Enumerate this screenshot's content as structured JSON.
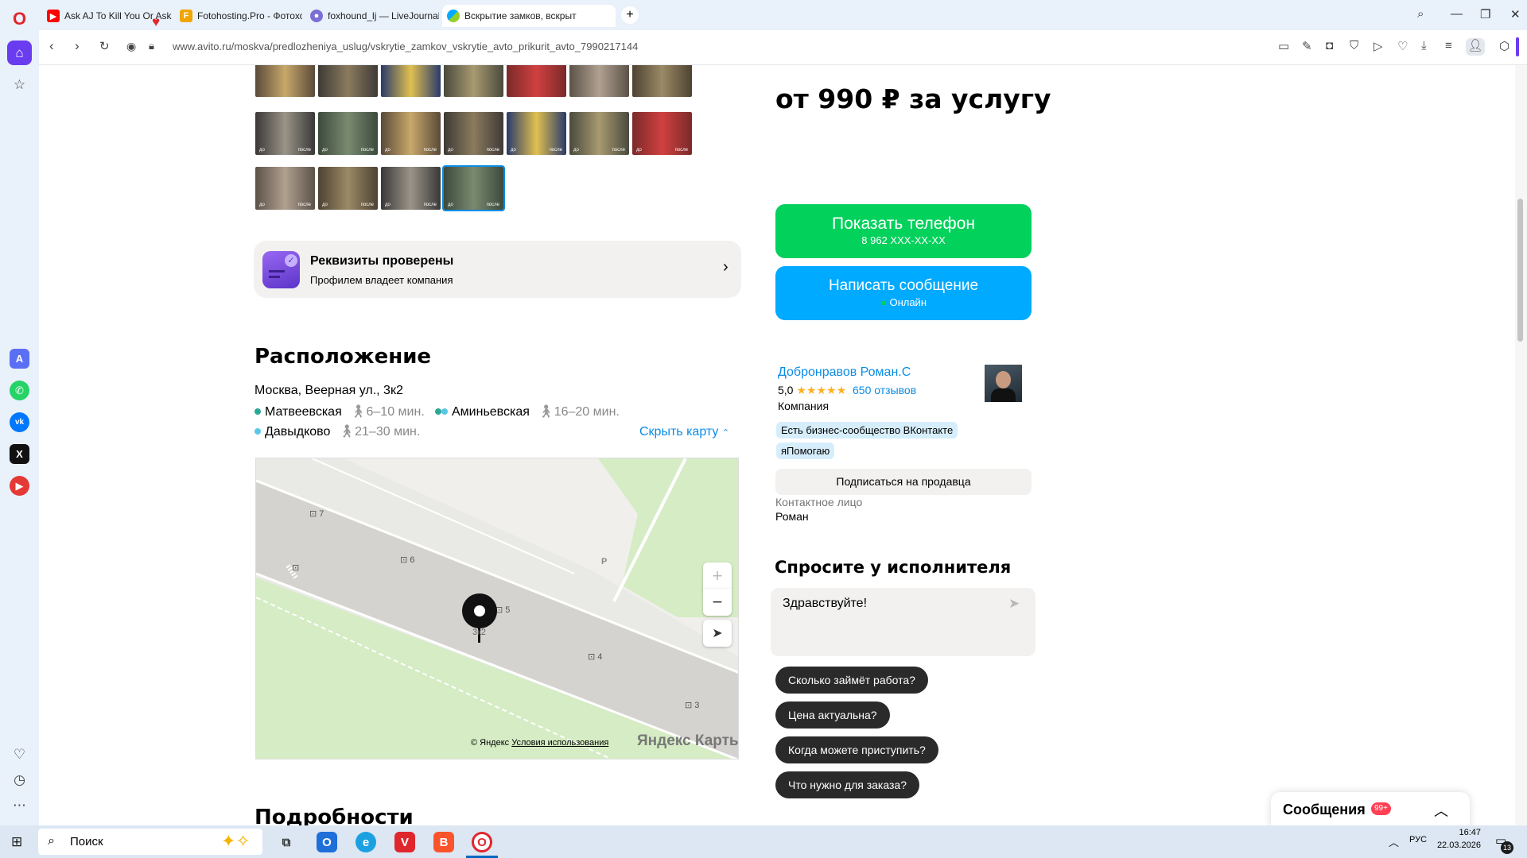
{
  "browser": {
    "tabs": [
      {
        "title": "Ask AJ To Kill You Or Ask",
        "icon": "youtube-icon"
      },
      {
        "title": "Fotohosting.Pro - Фотохо",
        "icon": "fotohosting-icon"
      },
      {
        "title": "foxhound_lj — LiveJournal",
        "icon": "livejournal-icon"
      },
      {
        "title": "Вскрытие замков, вскрыт",
        "icon": "avito-icon"
      }
    ],
    "new_tab": "+",
    "url": "www.avito.ru/moskva/predlozheniya_uslug/vskrytie_zamkov_vskrytie_avto_prikurit_avto_7990217144"
  },
  "listing": {
    "price": "от 990 ₽ за услугу",
    "photo_labels": {
      "before": "до",
      "after": "после"
    },
    "verified": {
      "title": "Реквизиты проверены",
      "subtitle": "Профилем владеет компания"
    },
    "location": {
      "heading": "Расположение",
      "address": "Москва, Веерная ул., 3к2",
      "metro": [
        {
          "name": "Матвеевская",
          "time": "6–10 мин.",
          "color": "#2aa897"
        },
        {
          "name": "Аминьевская",
          "time": "16–20 мин.",
          "color": "#2aa897"
        },
        {
          "name": "Давыдково",
          "time": "21–30 мин.",
          "color": "#5ac8e5"
        }
      ],
      "hide_map": "Скрыть карту"
    },
    "map": {
      "houses": [
        "7",
        "6",
        "5",
        "4",
        "3"
      ],
      "pin_label": "3к2",
      "parking": "P",
      "copyright": "© Яндекс",
      "terms": "Условия использования",
      "brand": "Яндекс Карты"
    },
    "details_heading": "Подробности"
  },
  "contact": {
    "show_phone": "Показать телефон",
    "phone_mask": "8 962 XXX-XX-XX",
    "write_message": "Написать сообщение",
    "online": "Онлайн"
  },
  "seller": {
    "name": "Добронравов Роман.С",
    "rating": "5,0",
    "stars": "★★★★★",
    "reviews": "650 отзывов",
    "type": "Компания",
    "badges": [
      "Есть бизнес-сообщество ВКонтакте",
      "яПомогаю"
    ],
    "subscribe": "Подписаться на продавца",
    "contact_label": "Контактное лицо",
    "contact_name": "Роман"
  },
  "ask": {
    "heading": "Спросите у исполнителя",
    "input_value": "Здравствуйте!",
    "questions": [
      "Сколько займёт работа?",
      "Цена актуальна?",
      "Когда можете приступить?",
      "Что нужно для заказа?"
    ]
  },
  "messages": {
    "label": "Сообщения",
    "badge": "99+"
  },
  "taskbar": {
    "search_placeholder": "Поиск",
    "lang": "РУС",
    "time": "16:47",
    "date": "22.03.2026",
    "notifications": "13"
  }
}
